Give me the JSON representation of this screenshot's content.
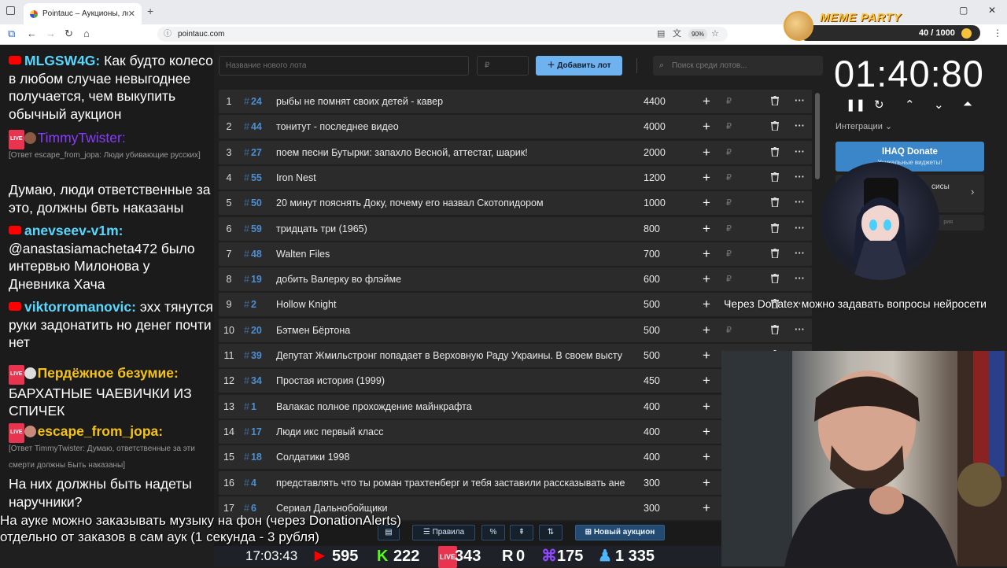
{
  "browser": {
    "tab_title": "Pointauc – Аукционы, лотереи",
    "url": "pointauc.com",
    "zoom": "90%"
  },
  "meme_party": {
    "title": "MEME PARTY",
    "progress": "40 / 1000",
    "progress_fraction": 0.04
  },
  "chat": {
    "messages": [
      {
        "user": "MLGSW4G:",
        "user_color": "#59d8ff",
        "text": "Как будто колесо в любом случае невыгоднее получается, чем выкупить обычный аукцион"
      },
      {
        "user": "TimmyTwister:",
        "user_color": "#8a3bff",
        "text": "[Ответ escape_from_jopa: Люди убивающие русских]"
      },
      {
        "user": "",
        "text": "Думаю, люди ответственные за это, должны бвть наказаны"
      },
      {
        "user": "anevseev-v1m:",
        "user_color": "#59d8ff",
        "text": "@anastasiamacheta472 было интервью Милонова у Дневника Хача"
      },
      {
        "user": "viktorromanovic:",
        "user_color": "#59d8ff",
        "text": "эхх тянутся руки задонатить но денег почти нет"
      },
      {
        "user": "Пердёжное безумие:",
        "user_color": "#f5c21b",
        "text": "БАРХАТНЫЕ ЧАЕВИЧКИ ИЗ СПИЧЕК"
      },
      {
        "user": "escape_from_jopa:",
        "user_color": "#f5c21b",
        "text": "[Ответ TimmyTwister: Думаю, ответственные за эти смерти должны Быть наказаны]"
      },
      {
        "user": "",
        "text": "На них должны быть надеты наручники?"
      }
    ]
  },
  "toolbar": {
    "lot_placeholder": "Название нового лота",
    "price_placeholder": "₽",
    "add_label": "Добавить лот",
    "search_placeholder": "Поиск среди лотов..."
  },
  "lots": [
    {
      "n": "1",
      "id": "24",
      "name": "рыбы не помнят своих детей - кавер",
      "amount": "4400"
    },
    {
      "n": "2",
      "id": "44",
      "name": "тонитут - последнее видео",
      "amount": "4000"
    },
    {
      "n": "3",
      "id": "27",
      "name": "поем песни Бутырки: запахло Весной, аттестат, шарик!",
      "amount": "2000"
    },
    {
      "n": "4",
      "id": "55",
      "name": "Iron Nest",
      "amount": "1200"
    },
    {
      "n": "5",
      "id": "50",
      "name": "20 минут пояснять Доку, почему его назвал Скотопидором",
      "amount": "1000"
    },
    {
      "n": "6",
      "id": "59",
      "name": "тридцать три (1965)",
      "amount": "800"
    },
    {
      "n": "7",
      "id": "48",
      "name": "Walten Files",
      "amount": "700"
    },
    {
      "n": "8",
      "id": "19",
      "name": "добить Валерку во флэйме",
      "amount": "600"
    },
    {
      "n": "9",
      "id": "2",
      "name": "Hollow Knight",
      "amount": "500"
    },
    {
      "n": "10",
      "id": "20",
      "name": "Бэтмен Бёртона",
      "amount": "500"
    },
    {
      "n": "11",
      "id": "39",
      "name": "Депутат Жмильстронг попадает в Верховную Раду Украины. В своем высту",
      "amount": "500"
    },
    {
      "n": "12",
      "id": "34",
      "name": "Простая история (1999)",
      "amount": "450"
    },
    {
      "n": "13",
      "id": "1",
      "name": "Валакас полное прохождение майнкрафта",
      "amount": "400"
    },
    {
      "n": "14",
      "id": "17",
      "name": "Люди икс первый класс",
      "amount": "400"
    },
    {
      "n": "15",
      "id": "18",
      "name": "Солдатики 1998",
      "amount": "400"
    },
    {
      "n": "16",
      "id": "4",
      "name": "представлять что ты роман трахтенберг и тебя заставили рассказывать ане",
      "amount": "300"
    },
    {
      "n": "17",
      "id": "6",
      "name": "Сериал Дальнобойщики",
      "amount": "300"
    }
  ],
  "bottom_bar": {
    "rules": "Правила",
    "percent": "%",
    "new_auction": "Новый аукцион"
  },
  "timer": {
    "value": "01:40:80",
    "integrations": "Интеграции ⌄",
    "ihaq_title": "IHAQ Donate",
    "ihaq_sub": "Уникальные виджеты!",
    "card2": "сисы",
    "card3": "рия"
  },
  "overlay": {
    "donatex": "Через Donatex можно задавать вопросы нейросети",
    "subtitle_line1": "На ауке можно заказывать музыку на фон (через DonationAlerts)",
    "subtitle_line2": "отдельно от заказов в сам аук (1 секунда - 3 рубля)"
  },
  "status": {
    "time": "17:03:43",
    "youtube": "595",
    "kick": "222",
    "live": "343",
    "r": "0",
    "twitch": "175",
    "viewers": "1 335"
  }
}
